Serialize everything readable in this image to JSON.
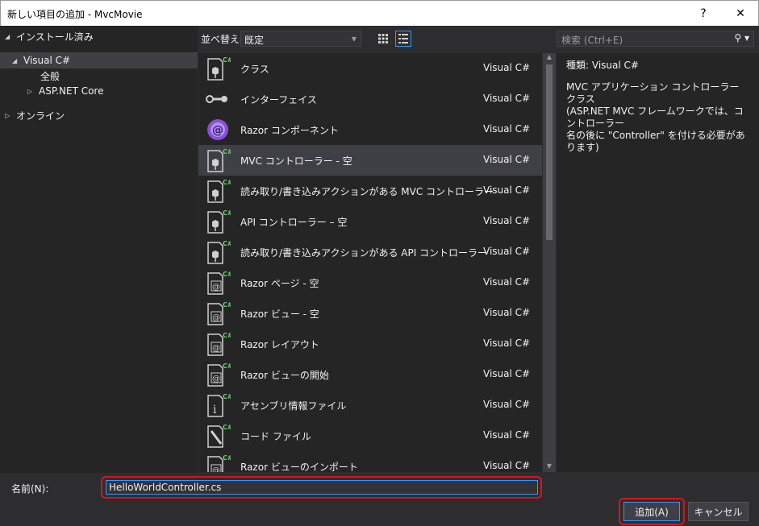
{
  "window": {
    "title": "新しい項目の追加 - MvcMovie",
    "help_label": "?",
    "close_label": "✕"
  },
  "tree": {
    "installed": "インストール済み",
    "visual_csharp": "Visual C#",
    "all": "全般",
    "aspnet_core": "ASP.NET Core",
    "online": "オンライン"
  },
  "toolbar": {
    "sort_label": "並べ替え:",
    "sort_value": "既定"
  },
  "search": {
    "placeholder": "検索 (Ctrl+E)"
  },
  "items": [
    {
      "name": "クラス",
      "lang": "Visual C#",
      "icon": "cs-class-icon"
    },
    {
      "name": "インターフェイス",
      "lang": "Visual C#",
      "icon": "interface-icon"
    },
    {
      "name": "Razor コンポーネント",
      "lang": "Visual C#",
      "icon": "razor-component-icon"
    },
    {
      "name": "MVC コントローラー - 空",
      "lang": "Visual C#",
      "icon": "cs-class-icon"
    },
    {
      "name": "読み取り/書き込みアクションがある MVC コントローラー",
      "lang": "Visual C#",
      "icon": "cs-class-icon"
    },
    {
      "name": "API コントローラー – 空",
      "lang": "Visual C#",
      "icon": "cs-class-icon"
    },
    {
      "name": "読み取り/書き込みアクションがある API コントローラー",
      "lang": "Visual C#",
      "icon": "cs-class-icon"
    },
    {
      "name": "Razor ページ - 空",
      "lang": "Visual C#",
      "icon": "razor-page-icon"
    },
    {
      "name": "Razor ビュー - 空",
      "lang": "Visual C#",
      "icon": "razor-page-icon"
    },
    {
      "name": "Razor レイアウト",
      "lang": "Visual C#",
      "icon": "razor-page-icon"
    },
    {
      "name": "Razor ビューの開始",
      "lang": "Visual C#",
      "icon": "razor-page-icon"
    },
    {
      "name": "アセンブリ情報ファイル",
      "lang": "Visual C#",
      "icon": "assembly-info-icon"
    },
    {
      "name": "コード ファイル",
      "lang": "Visual C#",
      "icon": "code-file-icon"
    },
    {
      "name": "Razor ビューのインポート",
      "lang": "Visual C#",
      "icon": "razor-page-icon"
    }
  ],
  "selected_index": 3,
  "details": {
    "kind_label": "種類:",
    "kind_value": "Visual C#",
    "desc_line1": "MVC アプリケーション コントローラー クラス",
    "desc_line2": "(ASP.NET MVC フレームワークでは、コントローラー",
    "desc_line3": "名の後に \"Controller\" を付ける必要があります)"
  },
  "bottom": {
    "name_label": "名前(N):",
    "name_value": "HelloWorldController.cs",
    "add_label": "追加(A)",
    "cancel_label": "キャンセル"
  },
  "colors": {
    "accent": "#3399ff",
    "highlight": "#e0101a",
    "csharp_badge": "#68d36b"
  }
}
